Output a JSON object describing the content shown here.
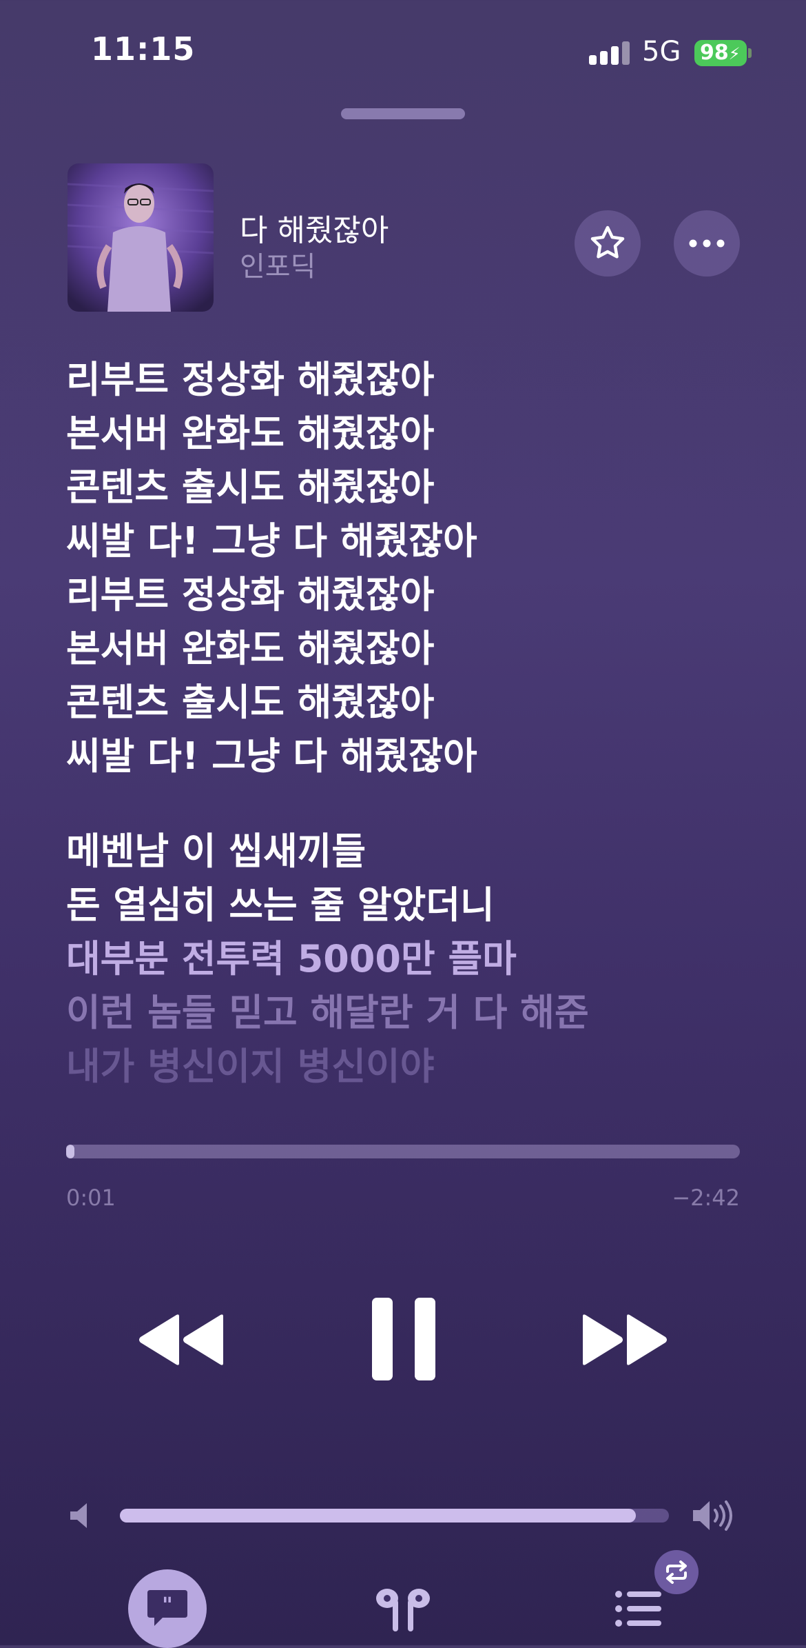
{
  "status_bar": {
    "time": "11:15",
    "network": "5G",
    "battery": "98"
  },
  "now_playing": {
    "title": "다 해줬잖아",
    "artist": "인포딕"
  },
  "lyrics": [
    {
      "text": "리부트 정상화 해줬잖아",
      "style": "active"
    },
    {
      "text": "본서버 완화도 해줬잖아",
      "style": "active"
    },
    {
      "text": "콘텐츠 출시도 해줬잖아",
      "style": "active"
    },
    {
      "text": "씨발 다! 그냥 다 해줬잖아",
      "style": "active"
    },
    {
      "text": "리부트 정상화 해줬잖아",
      "style": "active"
    },
    {
      "text": "본서버 완화도 해줬잖아",
      "style": "active"
    },
    {
      "text": "콘텐츠 출시도 해줬잖아",
      "style": "active"
    },
    {
      "text": "씨발 다! 그냥 다 해줬잖아",
      "style": "active"
    },
    {
      "text": "메벤남 이 씹새끼들",
      "style": "active"
    },
    {
      "text": "돈 열심히 쓰는 줄 알았더니",
      "style": "active"
    },
    {
      "text": "대부분 전투력 5000만 플마",
      "style": "dim1"
    },
    {
      "text": "이런 놈들 믿고 해달란 거 다 해준",
      "style": "dim2"
    },
    {
      "text": "내가 병신이지 병신이야",
      "style": "dim3"
    }
  ],
  "playback": {
    "elapsed": "0:01",
    "remaining": "−2:42",
    "progress_fraction": 0.01
  },
  "volume": {
    "level_fraction": 0.94
  },
  "colors": {
    "accent": "#b8a8e0",
    "battery_green": "#4cc95a"
  }
}
